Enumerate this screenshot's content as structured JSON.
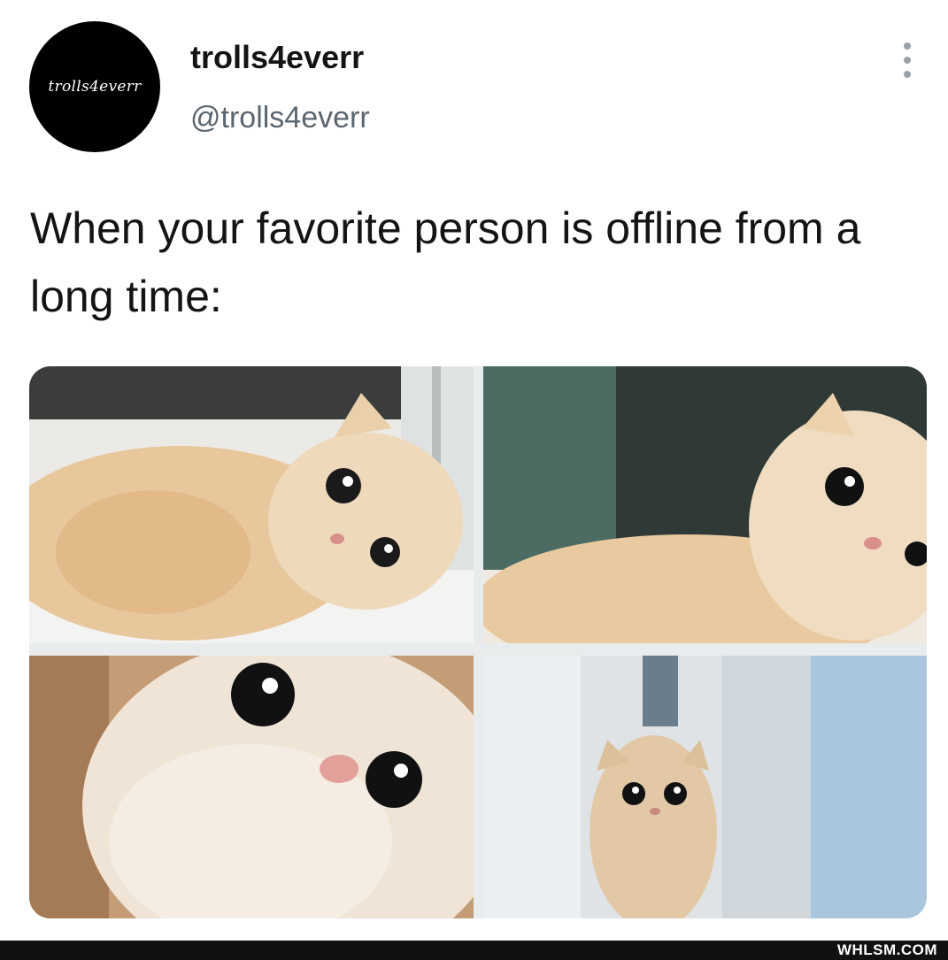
{
  "tweet": {
    "avatar_text": "trolls4everr",
    "display_name": "trolls4everr",
    "handle": "@trolls4everr",
    "more_icon": "vertical-ellipsis-icon",
    "text": "When your favorite person is offline from a long time:"
  },
  "media": {
    "images": [
      {
        "subject": "cat-lying-on-windowsill"
      },
      {
        "subject": "cat-looking-sideways"
      },
      {
        "subject": "cat-closeup-looking-up"
      },
      {
        "subject": "cat-peeking-behind-door"
      }
    ]
  },
  "watermark": "WHLSM.COM"
}
